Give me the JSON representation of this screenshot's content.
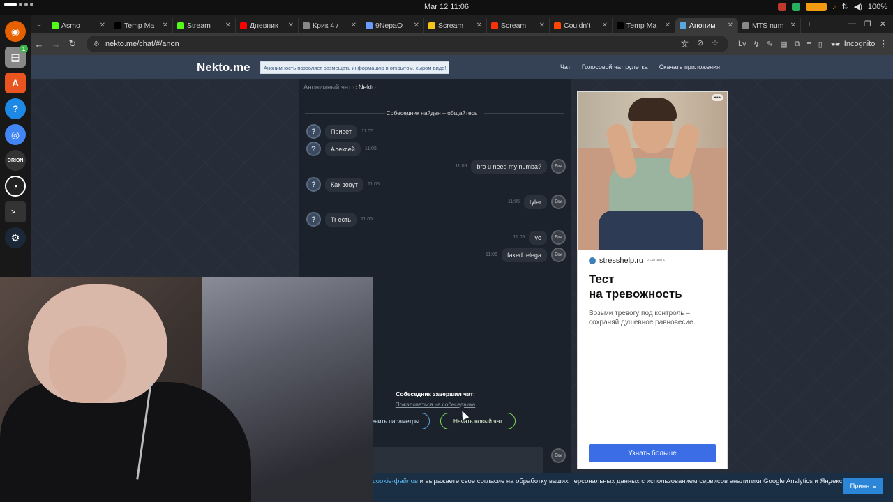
{
  "os": {
    "clock": "Mar 12  11:06",
    "battery": "100%"
  },
  "browser": {
    "tabs": [
      {
        "label": "Asmo",
        "color": "#53fc18",
        "glyph": "K"
      },
      {
        "label": "Temp Ma",
        "color": "#000000",
        "glyph": "X"
      },
      {
        "label": "Stream",
        "color": "#53fc18",
        "glyph": "K"
      },
      {
        "label": "Дневник",
        "color": "#ff0000",
        "glyph": "▶"
      },
      {
        "label": "Крик 4 /",
        "color": "#888888",
        "glyph": "◎"
      },
      {
        "label": "9NepaQ",
        "color": "#6a9bff",
        "glyph": "❖"
      },
      {
        "label": "Scream",
        "color": "#f5c518",
        "glyph": "▭"
      },
      {
        "label": "Scream",
        "color": "#fa320a",
        "glyph": "●"
      },
      {
        "label": "Couldn't",
        "color": "#ff4500",
        "glyph": "◉"
      },
      {
        "label": "Temp Ma",
        "color": "#000000",
        "glyph": "X"
      },
      {
        "label": "Аноним",
        "color": "#5aa6e0",
        "glyph": "▣",
        "active": true
      },
      {
        "label": "MTS num",
        "color": "#888888",
        "glyph": "G"
      }
    ],
    "url": "nekto.me/chat/#/anon",
    "incognito_label": "Incognito"
  },
  "site": {
    "logo": "Nekto.me",
    "notice": "Анонимность позволяет размещать информацию в открытом, сыром виде!",
    "nav": {
      "chat": "Чат",
      "voice": "Голосовой чат рулетка",
      "apps": "Скачать приложения"
    }
  },
  "chat": {
    "header_muted": "Анонимный чат",
    "header_rest": "с Nekto",
    "system": "Собеседник найден – общайтесь",
    "messages": [
      {
        "dir": "in",
        "text": "Привет",
        "time": "11:05"
      },
      {
        "dir": "in",
        "text": "Алексей",
        "time": "11:05"
      },
      {
        "dir": "out",
        "text": "bro u need my numba?",
        "time": "11:05"
      },
      {
        "dir": "in",
        "text": "Как зовут",
        "time": "11:05"
      },
      {
        "dir": "out",
        "text": "tyler",
        "time": "11:05"
      },
      {
        "dir": "in",
        "text": "Tr есть",
        "time": "11:05"
      },
      {
        "dir": "out",
        "text": "ye",
        "time": "11:05"
      },
      {
        "dir": "out",
        "text": "faked telega",
        "time": "11:06"
      }
    ],
    "me_avatar": "Вы",
    "ended_title": "Собеседник завершил чат:",
    "report_link": "Пожаловаться на собеседника",
    "change_params": "енить параметры",
    "new_chat": "Начать новый чат",
    "input_hint": "..."
  },
  "ad": {
    "menu": "•••",
    "domain": "stresshelp.ru",
    "tag": "РЕКЛАМА",
    "title_line1": "Тест",
    "title_line2": "на тревожность",
    "text": "Возьми тревогу под контроль – сохраняй душевное равновесие.",
    "button": "Узнать больше"
  },
  "cookie": {
    "link": "cookie-файлов",
    "text": " и выражаете свое согласие на обработку ваших персональных данных с использованием сервисов аналитики Google Analytics и Яндекс",
    "accept": "Принять"
  }
}
